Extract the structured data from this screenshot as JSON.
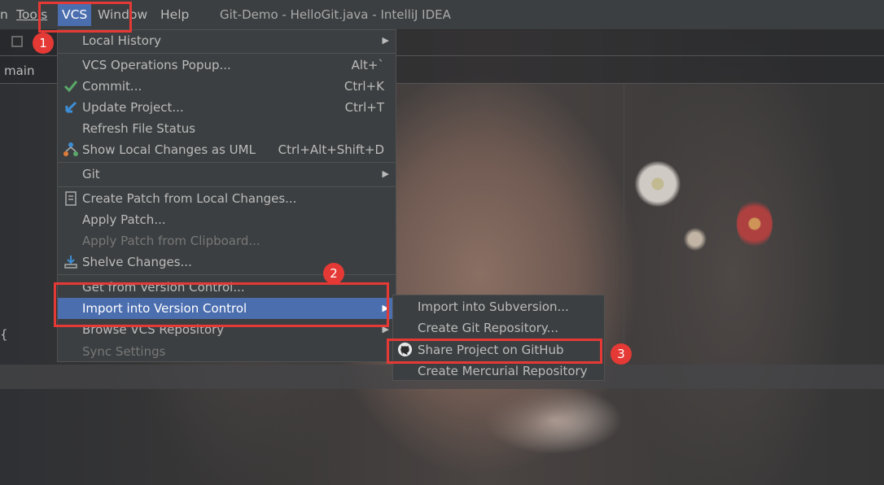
{
  "menubar": {
    "items": [
      {
        "label": "n"
      },
      {
        "label": "Tools"
      },
      {
        "label": "VCS"
      },
      {
        "label": "Window"
      },
      {
        "label": "Help"
      }
    ],
    "window_title": "Git-Demo - HelloGit.java - IntelliJ IDEA"
  },
  "editor": {
    "branch_label": "main",
    "brace": "{"
  },
  "vcs_menu": {
    "items": [
      {
        "label": "Local History",
        "has_submenu": true
      },
      {
        "label": "VCS Operations Popup...",
        "shortcut": "Alt+`"
      },
      {
        "label": "Commit...",
        "shortcut": "Ctrl+K",
        "icon": "check-icon"
      },
      {
        "label": "Update Project...",
        "shortcut": "Ctrl+T",
        "icon": "update-arrow-icon"
      },
      {
        "label": "Refresh File Status"
      },
      {
        "label": "Show Local Changes as UML",
        "shortcut": "Ctrl+Alt+Shift+D",
        "icon": "uml-icon"
      },
      {
        "label": "Git",
        "has_submenu": true
      },
      {
        "label": "Create Patch from Local Changes...",
        "icon": "patch-icon"
      },
      {
        "label": "Apply Patch..."
      },
      {
        "label": "Apply Patch from Clipboard...",
        "disabled": true
      },
      {
        "label": "Shelve Changes...",
        "icon": "shelve-icon"
      },
      {
        "label": "Get from Version Control..."
      },
      {
        "label": "Import into Version Control",
        "has_submenu": true,
        "highlighted": true
      },
      {
        "label": "Browse VCS Repository",
        "has_submenu": true
      },
      {
        "label": "Sync Settings",
        "disabled": true
      }
    ]
  },
  "import_submenu": {
    "items": [
      {
        "label": "Import into Subversion..."
      },
      {
        "label": "Create Git Repository..."
      },
      {
        "label": "Share Project on GitHub",
        "icon": "github-icon"
      },
      {
        "label": "Create Mercurial Repository"
      }
    ]
  },
  "annotations": {
    "step1": "1",
    "step2": "2",
    "step3": "3",
    "color": "#e53935"
  },
  "colors": {
    "highlight": "#4b6eaf",
    "menu_bg": "#3c3f41",
    "text": "#bbbbbb"
  }
}
